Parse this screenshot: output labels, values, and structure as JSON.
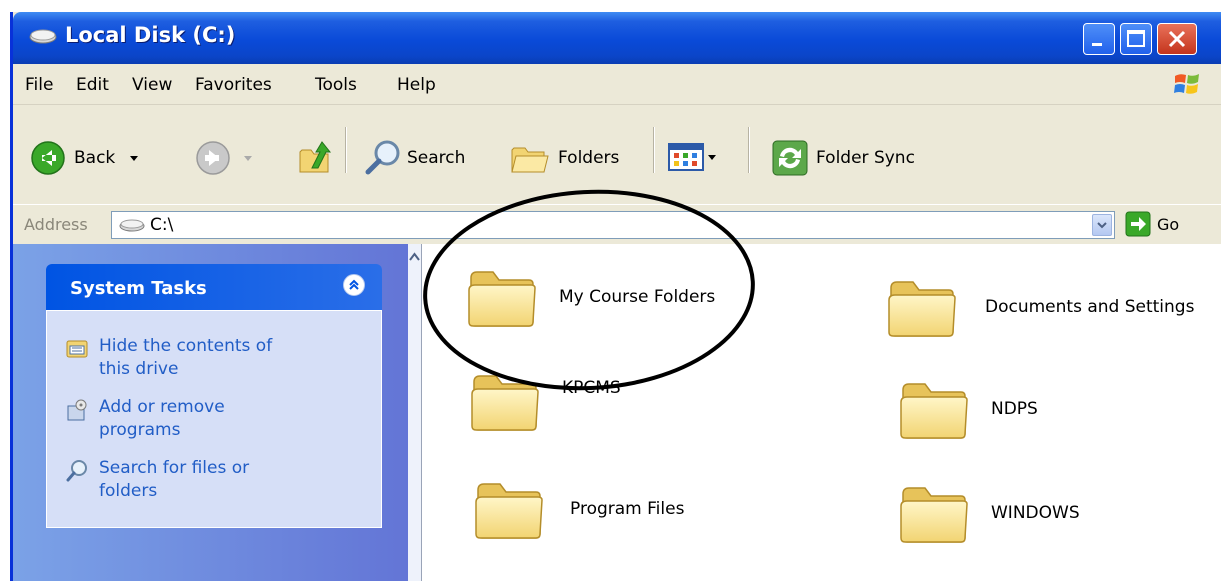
{
  "window": {
    "title": "Local Disk (C:)"
  },
  "menu": [
    "File",
    "Edit",
    "View",
    "Favorites",
    "Tools",
    "Help"
  ],
  "toolbar": {
    "back": "Back",
    "search": "Search",
    "folders": "Folders",
    "folder_sync": "Folder Sync"
  },
  "address": {
    "label": "Address",
    "value": "C:\\",
    "go": "Go"
  },
  "system_tasks": {
    "title": "System Tasks",
    "items": [
      {
        "label": "Hide the contents of this drive",
        "icon": "hide-contents-icon"
      },
      {
        "label": "Add or remove programs",
        "icon": "add-remove-programs-icon"
      },
      {
        "label": "Search for files or folders",
        "icon": "search-icon"
      }
    ]
  },
  "folders": [
    {
      "name": "My Course Folders",
      "icon": "folder-icon",
      "highlighted": true
    },
    {
      "name": "Documents and Settings",
      "icon": "folder-icon"
    },
    {
      "name": "KPCMS",
      "icon": "folder-icon"
    },
    {
      "name": "NDPS",
      "icon": "folder-icon"
    },
    {
      "name": "Program Files",
      "icon": "folder-icon"
    },
    {
      "name": "WINDOWS",
      "icon": "folder-icon"
    }
  ],
  "colors": {
    "title_bar": "#0a4ad8",
    "task_link": "#215dc6",
    "highlight_circle": "#000000"
  }
}
